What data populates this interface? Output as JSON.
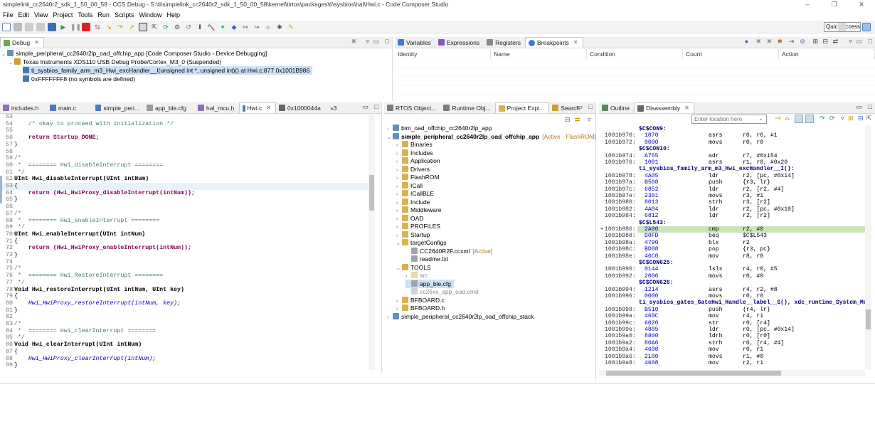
{
  "window": {
    "title": "simplelink_cc2640r2_sdk_1_50_00_58 - CCS Debug - S:\\ti\\simplelink_cc2640r2_sdk_1_50_00_58\\kernel\\tirtos\\packages\\ti\\sysbios\\hal\\Hwi.c - Code Composer Studio",
    "minimize": "–",
    "restore": "❐",
    "close": "✕"
  },
  "menu": [
    "File",
    "Edit",
    "View",
    "Project",
    "Tools",
    "Run",
    "Scripts",
    "Window",
    "Help"
  ],
  "toolbar": {
    "quick_access": "Quick Access"
  },
  "debug": {
    "tab": "Debug",
    "items": [
      "simple_peripheral_cc2640r2lp_oad_offchip_app [Code Composer Studio - Device Debugging]",
      "Texas Instruments XDS110 USB Debug Probe/Cortex_M3_0 (Suspended)",
      "ti_sysbios_family_arm_m3_Hwi_excHandler__I(unsigned int *, unsigned int)() at Hwi.c:877 0x1001B986",
      "0xFFFFFFF8  (no symbols are defined)"
    ]
  },
  "breakpoints": {
    "tabs": [
      "Variables",
      "Expressions",
      "Registers",
      "Breakpoints"
    ],
    "columns": [
      "Identity",
      "Name",
      "Condition",
      "Count",
      "Action"
    ]
  },
  "editor": {
    "tabs": [
      "includes.h",
      "main.c",
      "simple_peri...",
      "app_ble.cfg",
      "hal_mcu.h",
      "Hwi.c",
      "0x1000044a"
    ],
    "overflow": "»3",
    "lines": [
      {
        "n": "53",
        "t": ""
      },
      {
        "n": "54",
        "t": "    /* okay to proceed with initialization */"
      },
      {
        "n": "55",
        "t": ""
      },
      {
        "n": "56",
        "t": "    return Startup_DONE;"
      },
      {
        "n": "57",
        "t": "}"
      },
      {
        "n": "58",
        "t": ""
      },
      {
        "n": "59",
        "t": "/*"
      },
      {
        "n": "60",
        "t": " *  ======== Hwi_disableInterrupt ========"
      },
      {
        "n": "61",
        "t": " */"
      },
      {
        "n": "62",
        "t": "UInt Hwi_disableInterrupt(UInt intNum)"
      },
      {
        "n": "63",
        "t": "{"
      },
      {
        "n": "64",
        "t": "    return (Hwi_HwiProxy_disableInterrupt(intNum));"
      },
      {
        "n": "65",
        "t": "}"
      },
      {
        "n": "66",
        "t": ""
      },
      {
        "n": "67",
        "t": "/*"
      },
      {
        "n": "68",
        "t": " *  ======== Hwi_enableInterrupt ========"
      },
      {
        "n": "69",
        "t": " */"
      },
      {
        "n": "70",
        "t": "UInt Hwi_enableInterrupt(UInt intNum)"
      },
      {
        "n": "71",
        "t": "{"
      },
      {
        "n": "72",
        "t": "    return (Hwi_HwiProxy_enableInterrupt(intNum));"
      },
      {
        "n": "73",
        "t": "}"
      },
      {
        "n": "74",
        "t": ""
      },
      {
        "n": "75",
        "t": "/*"
      },
      {
        "n": "76",
        "t": " *  ======== Hwi_RestoreInterrupt ========"
      },
      {
        "n": "77",
        "t": " */"
      },
      {
        "n": "78",
        "t": "Void Hwi_restoreInterrupt(UInt intNum, UInt key)"
      },
      {
        "n": "79",
        "t": "{"
      },
      {
        "n": "80",
        "t": "    Hwi_HwiProxy_restoreInterrupt(intNum, key);"
      },
      {
        "n": "81",
        "t": "}"
      },
      {
        "n": "82",
        "t": ""
      },
      {
        "n": "83",
        "t": "/*"
      },
      {
        "n": "84",
        "t": " *  ======== Hwi_clearInterrupt ========"
      },
      {
        "n": "85",
        "t": " */"
      },
      {
        "n": "86",
        "t": "Void Hwi_clearInterrupt(UInt intNum)"
      },
      {
        "n": "87",
        "t": "{"
      },
      {
        "n": "88",
        "t": "    Hwi_HwiProxy_clearInterrupt(intNum);"
      },
      {
        "n": "89",
        "t": "}"
      }
    ]
  },
  "project": {
    "tabs": [
      "RTOS Object...",
      "Runtime Obj...",
      "Project Expl...",
      "Search"
    ],
    "items": [
      {
        "label": "bim_oad_offchip_cc2640r2lp_app",
        "depth": 0,
        "tw": "›"
      },
      {
        "label": "simple_peripheral_cc2640r2lp_oad_offchip_app",
        "depth": 0,
        "tw": "⌄",
        "extra": "[Active - FlashROM]",
        "bold": true
      },
      {
        "label": "Binaries",
        "depth": 1,
        "tw": "›"
      },
      {
        "label": "Includes",
        "depth": 1,
        "tw": "›"
      },
      {
        "label": "Application",
        "depth": 1,
        "tw": "›"
      },
      {
        "label": "Drivers",
        "depth": 1,
        "tw": "›"
      },
      {
        "label": "FlashROM",
        "depth": 1,
        "tw": "›"
      },
      {
        "label": "ICall",
        "depth": 1,
        "tw": "›"
      },
      {
        "label": "ICallBLE",
        "depth": 1,
        "tw": "›"
      },
      {
        "label": "Include",
        "depth": 1,
        "tw": "›"
      },
      {
        "label": "Middleware",
        "depth": 1,
        "tw": "›"
      },
      {
        "label": "OAD",
        "depth": 1,
        "tw": "›"
      },
      {
        "label": "PROFILES",
        "depth": 1,
        "tw": "›"
      },
      {
        "label": "Startup",
        "depth": 1,
        "tw": "›"
      },
      {
        "label": "targetConfigs",
        "depth": 1,
        "tw": "⌄"
      },
      {
        "label": "CC2640R2F.ccxml",
        "depth": 2,
        "tw": "",
        "extra": "[Active]"
      },
      {
        "label": "readme.txt",
        "depth": 2,
        "tw": ""
      },
      {
        "label": "TOOLS",
        "depth": 1,
        "tw": "⌄"
      },
      {
        "label": "src",
        "depth": 2,
        "tw": "›",
        "gray": true
      },
      {
        "label": "app_ble.cfg",
        "depth": 2,
        "tw": "",
        "sel": true
      },
      {
        "label": "cc26xx_app_oad.cmd",
        "depth": 2,
        "tw": "",
        "gray": true
      },
      {
        "label": "BFBOARD.c",
        "depth": 1,
        "tw": "›"
      },
      {
        "label": "BFBOARD.h",
        "depth": 1,
        "tw": "›"
      },
      {
        "label": "simple_peripheral_cc2640r2lp_oad_offchip_stack",
        "depth": 0,
        "tw": "›"
      }
    ]
  },
  "disasm": {
    "tabs": [
      "Outline",
      "Disassembly"
    ],
    "location_placeholder": "Enter location here",
    "lines": [
      {
        "type": "label",
        "t": "$C$CON9:"
      },
      {
        "type": "ins",
        "a": "1001b970:",
        "h": "1070",
        "m": "asrs",
        "o": "r0, r6, #1"
      },
      {
        "type": "ins",
        "a": "1001b972:",
        "h": "0000",
        "m": "movs",
        "o": "r0, r0"
      },
      {
        "type": "label",
        "t": "$C$CON10:"
      },
      {
        "type": "ins",
        "a": "1001b974:",
        "h": "A755",
        "m": "adr",
        "o": "r7, #0x154"
      },
      {
        "type": "ins",
        "a": "1001b976:",
        "h": "1001",
        "m": "asrs",
        "o": "r1, r0, #0x20"
      },
      {
        "type": "label",
        "t": "ti_sysbios_family_arm_m3_Hwi_excHandler__I():"
      },
      {
        "type": "ins",
        "a": "1001b978:",
        "h": "4A05",
        "m": "ldr",
        "o": "r2, [pc, #0x14]"
      },
      {
        "type": "ins",
        "a": "1001b97a:",
        "h": "B508",
        "m": "push",
        "o": "{r3, lr}"
      },
      {
        "type": "ins",
        "a": "1001b97c:",
        "h": "6852",
        "m": "ldr",
        "o": "r2, [r2, #4]"
      },
      {
        "type": "ins",
        "a": "1001b97e:",
        "h": "2301",
        "m": "movs",
        "o": "r3, #1"
      },
      {
        "type": "ins",
        "a": "1001b980:",
        "h": "8013",
        "m": "strh",
        "o": "r3, [r2]"
      },
      {
        "type": "ins",
        "a": "1001b982:",
        "h": "4A04",
        "m": "ldr",
        "o": "r2, [pc, #0x10]"
      },
      {
        "type": "ins",
        "a": "1001b984:",
        "h": "6812",
        "m": "ldr",
        "o": "r2, [r2]"
      },
      {
        "type": "label",
        "t": "$C$L543:"
      },
      {
        "type": "ins",
        "a": "1001b986:",
        "h": "2A00",
        "m": "cmp",
        "o": "r2, #0",
        "cur": true
      },
      {
        "type": "ins",
        "a": "1001b988:",
        "h": "D0FD",
        "m": "beq",
        "o": "$C$L543"
      },
      {
        "type": "ins",
        "a": "1001b98a:",
        "h": "4790",
        "m": "blx",
        "o": "r2"
      },
      {
        "type": "ins",
        "a": "1001b98c:",
        "h": "BD08",
        "m": "pop",
        "o": "{r3, pc}"
      },
      {
        "type": "ins",
        "a": "1001b98e:",
        "h": "46C0",
        "m": "mov",
        "o": "r8, r8"
      },
      {
        "type": "label",
        "t": "$C$CON625:"
      },
      {
        "type": "ins",
        "a": "1001b990:",
        "h": "0144",
        "m": "lsls",
        "o": "r4, r0, #5"
      },
      {
        "type": "ins",
        "a": "1001b992:",
        "h": "2000",
        "m": "movs",
        "o": "r0, #0"
      },
      {
        "type": "label",
        "t": "$C$CON626:"
      },
      {
        "type": "ins",
        "a": "1001b994:",
        "h": "1214",
        "m": "asrs",
        "o": "r4, r2, #8"
      },
      {
        "type": "ins",
        "a": "1001b996:",
        "h": "0000",
        "m": "movs",
        "o": "r0, r0"
      },
      {
        "type": "label",
        "t": "ti_sysbios_gates_GateHwi_Handle__label__S(), xdc_runtime_System_Module"
      },
      {
        "type": "ins",
        "a": "1001b998:",
        "h": "B510",
        "m": "push",
        "o": "{r4, lr}"
      },
      {
        "type": "ins",
        "a": "1001b99a:",
        "h": "460C",
        "m": "mov",
        "o": "r4, r1"
      },
      {
        "type": "ins",
        "a": "1001b99c:",
        "h": "6020",
        "m": "str",
        "o": "r0, [r4]"
      },
      {
        "type": "ins",
        "a": "1001b99e:",
        "h": "4805",
        "m": "ldr",
        "o": "r0, [pc, #0x14]"
      },
      {
        "type": "ins",
        "a": "1001b9a0:",
        "h": "8800",
        "m": "ldrh",
        "o": "r0, [r0]"
      },
      {
        "type": "ins",
        "a": "1001b9a2:",
        "h": "80A0",
        "m": "strh",
        "o": "r0, [r4, #4]"
      },
      {
        "type": "ins",
        "a": "1001b9a4:",
        "h": "4608",
        "m": "mov",
        "o": "r0, r1"
      },
      {
        "type": "ins",
        "a": "1001b9a6:",
        "h": "2100",
        "m": "movs",
        "o": "r1, #0"
      },
      {
        "type": "ins",
        "a": "1001b9a8:",
        "h": "4608",
        "m": "mov",
        "o": "r2, r1"
      }
    ]
  }
}
